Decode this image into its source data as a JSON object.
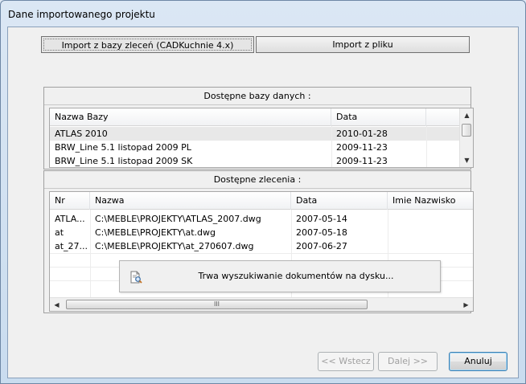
{
  "window": {
    "title": "Dane importowanego projektu"
  },
  "tabs": [
    {
      "label": "Import z bazy zleceń (CADKuchnie 4.x)",
      "active": true
    },
    {
      "label": "Import z pliku",
      "active": false
    }
  ],
  "databases": {
    "group_title": "Dostępne bazy danych :",
    "columns": [
      "Nazwa Bazy",
      "Data"
    ],
    "rows": [
      [
        "ATLAS 2010",
        "2010-01-28"
      ],
      [
        "BRW_Line 5.1 listopad 2009 PL",
        "2009-11-23"
      ],
      [
        "BRW_Line 5.1 listopad 2009 SK",
        "2009-11-23"
      ]
    ]
  },
  "orders": {
    "group_title": "Dostępne zlecenia :",
    "columns": [
      "Nr",
      "Nazwa",
      "Data",
      "Imie Nazwisko"
    ],
    "rows": [
      [
        "ATLA...",
        "C:\\MEBLE\\PROJEKTY\\ATLAS_2007.dwg",
        "2007-05-14",
        ""
      ],
      [
        "at",
        "C:\\MEBLE\\PROJEKTY\\at.dwg",
        "2007-05-18",
        ""
      ],
      [
        "at_27...",
        "C:\\MEBLE\\PROJEKTY\\at_270607.dwg",
        "2007-06-27",
        ""
      ]
    ],
    "scroll_thumb_grip": "III"
  },
  "busy": {
    "message": "Trwa wyszukiwanie dokumentów na dysku...",
    "icon": "search-document-icon"
  },
  "buttons": {
    "back": "<< Wstecz",
    "next": "Dalej >>",
    "cancel": "Anuluj"
  },
  "colors": {
    "selected_row": "#e8e8e8",
    "default_button_border": "#3c7fb1"
  }
}
